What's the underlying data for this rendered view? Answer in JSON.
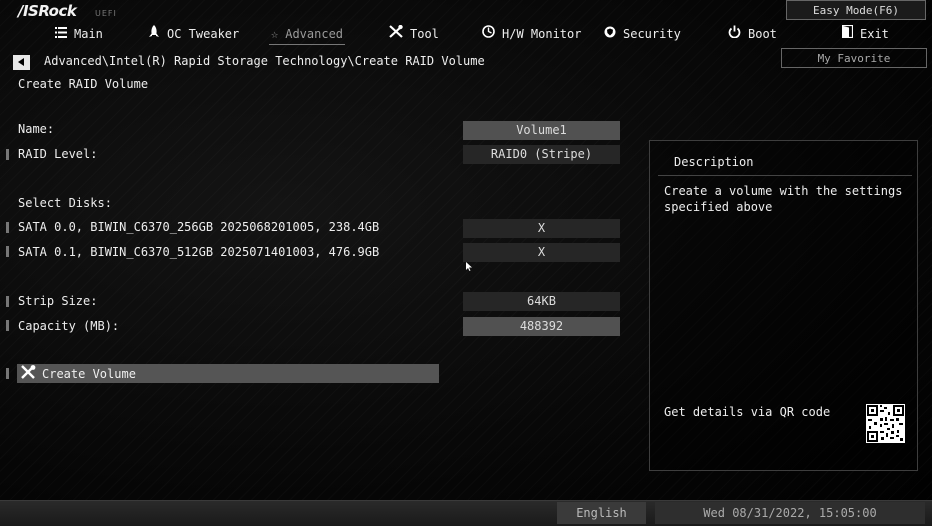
{
  "header": {
    "logo": "/ISRock",
    "logo_suffix": "UEFI",
    "easy_mode_label": "Easy Mode(F6)",
    "tabs": [
      {
        "label": "Main",
        "icon": "list-icon"
      },
      {
        "label": "OC Tweaker",
        "icon": "rocket-icon"
      },
      {
        "label": "Advanced",
        "icon": "star-icon",
        "active": true
      },
      {
        "label": "Tool",
        "icon": "tools-icon"
      },
      {
        "label": "H/W Monitor",
        "icon": "monitor-icon"
      },
      {
        "label": "Security",
        "icon": "shield-icon"
      },
      {
        "label": "Boot",
        "icon": "power-icon"
      },
      {
        "label": "Exit",
        "icon": "exit-door-icon"
      }
    ],
    "my_favorite_label": "My Favorite"
  },
  "breadcrumb": "Advanced\\Intel(R) Rapid Storage Technology\\Create RAID Volume",
  "page_title": "Create RAID Volume",
  "options": {
    "name": {
      "label": "Name:",
      "value": "Volume1"
    },
    "raid_level": {
      "label": "RAID Level:",
      "value": "RAID0 (Stripe)"
    },
    "select_disks_label": "Select Disks:",
    "disks": [
      {
        "label": "SATA 0.0, BIWIN_C6370_256GB 2025068201005, 238.4GB",
        "value": "X"
      },
      {
        "label": "SATA 0.1, BIWIN_C6370_512GB 2025071401003, 476.9GB",
        "value": "X"
      }
    ],
    "strip_size": {
      "label": "Strip Size:",
      "value": "64KB"
    },
    "capacity": {
      "label": "Capacity (MB):",
      "value": "488392"
    },
    "create_volume_label": "Create Volume"
  },
  "description": {
    "title": "Description",
    "text": "Create a volume with the settings specified above",
    "qr_label": "Get details via QR code"
  },
  "footer": {
    "language": "English",
    "datetime": "Wed 08/31/2022, 15:05:00"
  },
  "colors": {
    "background": "#000000",
    "selected_row": "#555555",
    "value_box_light": "#515151",
    "value_box_dark": "#262626"
  }
}
